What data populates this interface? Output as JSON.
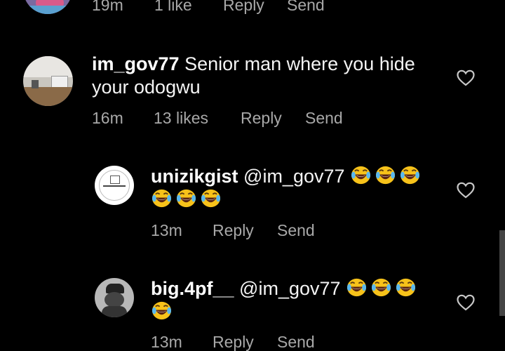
{
  "top_comment": {
    "time": "19m",
    "likes": "1 like",
    "reply": "Reply",
    "send": "Send"
  },
  "comments": [
    {
      "username": "im_gov77",
      "text": "Senior man where you hide your odogwu",
      "time": "16m",
      "likes": "13 likes",
      "reply": "Reply",
      "send": "Send"
    },
    {
      "username": "unizikgist",
      "mention": "@im_gov77",
      "emoji": "face-with-tears-of-joy",
      "emoji_count": 6,
      "time": "13m",
      "reply": "Reply",
      "send": "Send"
    },
    {
      "username": "big.4pf__",
      "mention": "@im_gov77",
      "emoji": "face-with-tears-of-joy",
      "emoji_count": 4,
      "time": "13m",
      "reply": "Reply",
      "send": "Send"
    }
  ],
  "colors": {
    "background": "#000000",
    "text": "#f4f4f4",
    "secondary_text": "#a8a8a8"
  }
}
